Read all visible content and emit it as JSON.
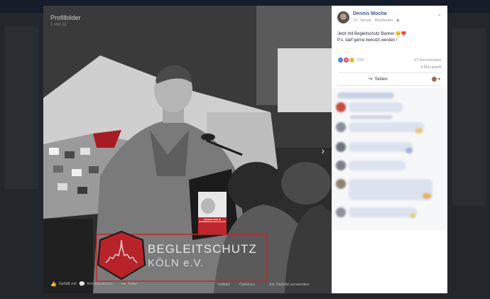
{
  "viewer": {
    "album_title": "Profilbilder",
    "photo_position": "1 von 11",
    "banner_line1": "BEGLEITSCHUTZ",
    "banner_line2": "KÖLN e.V.",
    "sign_text": "WIDERSTAND IN NORDRHEIN-WESTFALEN",
    "bottom_actions": [
      "Gefällt mir",
      "Kommentieren",
      "Teilen"
    ],
    "bottom_right": [
      "Vollbild",
      "Optionen",
      "Als Titelbild verwenden"
    ]
  },
  "post": {
    "author": "Dennis Mocha",
    "date": "15. Januar",
    "edited": "Bearbeitet",
    "text_line1": "Jetzt mit Begleitschutz Banner 😊❤️",
    "text_line2": "P.s. darf gerne benutzt werden !",
    "reaction_count": "239",
    "comments_count": "37 Kommentare",
    "shares_count": "4 Mal geteilt",
    "share_label": "Teilen"
  },
  "colors": {
    "brand": "#385898",
    "banner_red": "#c0272d",
    "like": "#3b7be8",
    "love": "#f0446a",
    "wow": "#f7c43f"
  }
}
